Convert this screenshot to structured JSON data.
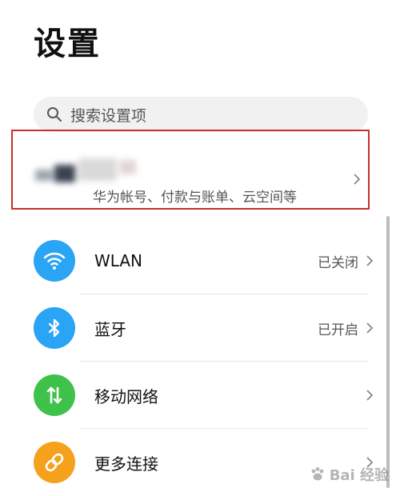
{
  "header": {
    "title": "设置"
  },
  "search": {
    "placeholder": "搜索设置项"
  },
  "account": {
    "subtitle": "华为帐号、付款与账单、云空间等"
  },
  "settings": [
    {
      "label": "WLAN",
      "status": "已关闭",
      "icon": "wifi-icon",
      "color": "#2aa4f4"
    },
    {
      "label": "蓝牙",
      "status": "已开启",
      "icon": "bluetooth-icon",
      "color": "#2aa4f4"
    },
    {
      "label": "移动网络",
      "status": "",
      "icon": "mobile-data-icon",
      "color": "#3fc24a"
    },
    {
      "label": "更多连接",
      "status": "",
      "icon": "link-icon",
      "color": "#f5a11b"
    }
  ],
  "colors": {
    "accent_red": "#c9302c"
  },
  "watermark": {
    "text": "Bai 经验"
  }
}
